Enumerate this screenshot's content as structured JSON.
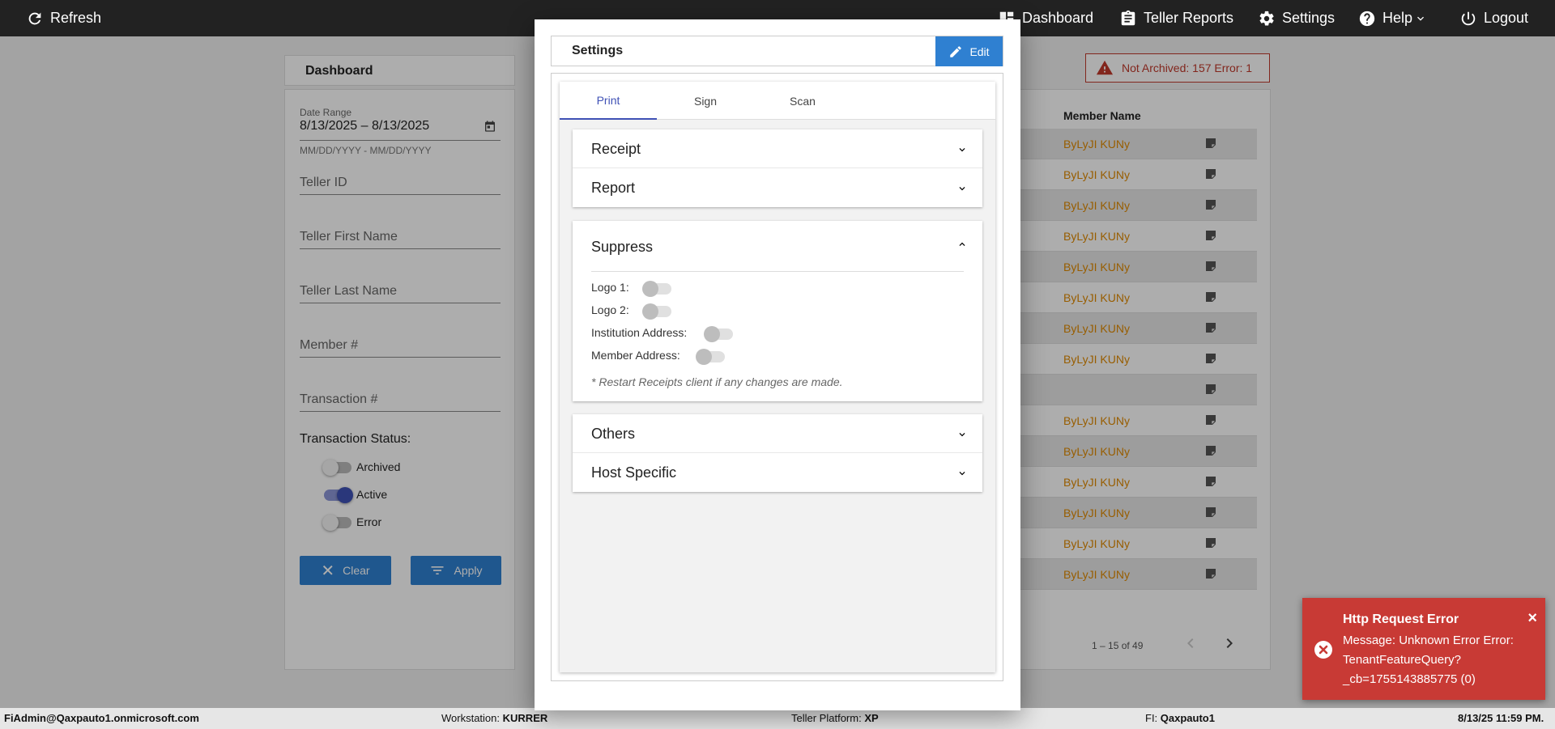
{
  "topbar": {
    "refresh": "Refresh",
    "dashboard": "Dashboard",
    "teller_reports": "Teller Reports",
    "settings": "Settings",
    "help": "Help",
    "logout": "Logout"
  },
  "dashboard": {
    "title": "Dashboard",
    "filters": {
      "date_range_label": "Date Range",
      "date_range_value": "8/13/2025 – 8/13/2025",
      "date_hint": "MM/DD/YYYY - MM/DD/YYYY",
      "teller_id": "Teller ID",
      "teller_first_name": "Teller First Name",
      "teller_last_name": "Teller Last Name",
      "member_number": "Member #",
      "transaction_number": "Transaction #",
      "transaction_status_label": "Transaction Status:",
      "statuses": [
        {
          "label": "Archived",
          "on": false
        },
        {
          "label": "Active",
          "on": true
        },
        {
          "label": "Error",
          "on": false
        }
      ],
      "clear_label": "Clear",
      "apply_label": "Apply"
    },
    "error_summary": "Not Archived: 157  Error: 1",
    "table": {
      "member_name_header": "Member Name",
      "rows": [
        "ByLyJI KUNy",
        "ByLyJI KUNy",
        "ByLyJI KUNy",
        "ByLyJI KUNy",
        "ByLyJI KUNy",
        "ByLyJI KUNy",
        "ByLyJI KUNy",
        "ByLyJI KUNy",
        "",
        "ByLyJI KUNy",
        "ByLyJI KUNy",
        "ByLyJI KUNy",
        "ByLyJI KUNy",
        "ByLyJI KUNy",
        "ByLyJI KUNy"
      ],
      "pager": "1 – 15 of 49"
    }
  },
  "modal": {
    "title": "Settings",
    "edit_label": "Edit",
    "tabs": [
      "Print",
      "Sign",
      "Scan"
    ],
    "active_tab": "Print",
    "sections": {
      "receipt": "Receipt",
      "report": "Report",
      "suppress": "Suppress",
      "others": "Others",
      "host_specific": "Host Specific"
    },
    "suppress_switches": [
      {
        "label": "Logo 1:",
        "on": false
      },
      {
        "label": "Logo 2:",
        "on": false
      },
      {
        "label": "Institution Address:",
        "on": false
      },
      {
        "label": "Member Address:",
        "on": false
      }
    ],
    "suppress_note": "* Restart Receipts client if any changes are made."
  },
  "toast": {
    "title": "Http Request Error",
    "message": "Message: Unknown Error Error: TenantFeatureQuery?_cb=1755143885775 (0)",
    "close": "×"
  },
  "statusbar": {
    "user": "FiAdmin@Qaxpauto1.onmicrosoft.com",
    "workstation_label": "Workstation:",
    "workstation": "KURRER",
    "platform_label": "Teller Platform:",
    "platform": "XP",
    "fi_label": "FI:",
    "fi": "Qaxpauto1",
    "datetime": "8/13/25 11:59 PM."
  },
  "colors": {
    "accent_blue": "#2f80d1",
    "tab_active": "#3f51b5",
    "error_red": "#c83a35",
    "member_name": "#e08a00"
  }
}
